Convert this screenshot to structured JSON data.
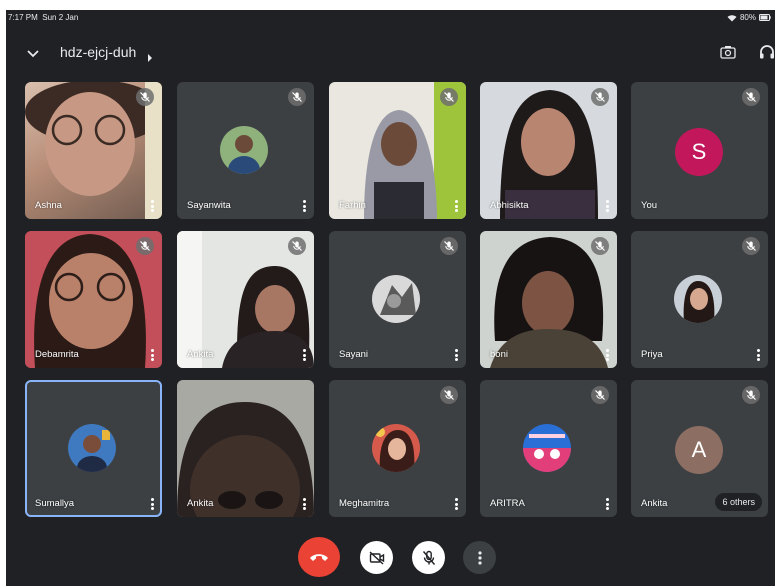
{
  "status_bar": {
    "time": "7:17 PM",
    "date": "Sun 2 Jan",
    "battery": "80%",
    "icons": [
      "wifi-icon",
      "battery-icon"
    ]
  },
  "header": {
    "meeting_code": "hdz-ejcj-duh",
    "icons": [
      "chevron-down-icon",
      "caret-right-icon",
      "switch-camera-icon",
      "headphones-icon"
    ]
  },
  "participants": [
    {
      "name": "Ashna",
      "view": "video",
      "muted": true
    },
    {
      "name": "Sayanwita",
      "view": "photo",
      "muted": true
    },
    {
      "name": "Farhin",
      "view": "video",
      "muted": true
    },
    {
      "name": "Abhisikta",
      "view": "video",
      "muted": true
    },
    {
      "name": "You",
      "view": "letter",
      "letter": "S",
      "muted": true
    },
    {
      "name": "Debamrita",
      "view": "video",
      "muted": true
    },
    {
      "name": "Ankita",
      "view": "video",
      "muted": true
    },
    {
      "name": "Sayani",
      "view": "photo",
      "muted": true
    },
    {
      "name": "boni",
      "view": "video",
      "muted": true
    },
    {
      "name": "Priya",
      "view": "photo",
      "muted": true
    },
    {
      "name": "Sumallya",
      "view": "photo",
      "muted": false,
      "active_speaker": true
    },
    {
      "name": "Ankita",
      "view": "video",
      "muted": false
    },
    {
      "name": "Meghamitra",
      "view": "photo",
      "muted": true
    },
    {
      "name": "ARITRA",
      "view": "photo",
      "muted": true
    },
    {
      "name": "Ankita",
      "view": "letter",
      "letter": "A",
      "muted": true,
      "others_badge": "6 others"
    }
  ],
  "colors": {
    "background": "#202124",
    "tile": "#3c4043",
    "active_outline": "#8ab4f8",
    "end_call": "#ea4335",
    "avatar_s": "#c2185b",
    "avatar_a": "#8d6e63"
  },
  "controls": [
    "end-call-icon",
    "camera-off-icon",
    "mic-off-icon",
    "more-vertical-icon"
  ]
}
